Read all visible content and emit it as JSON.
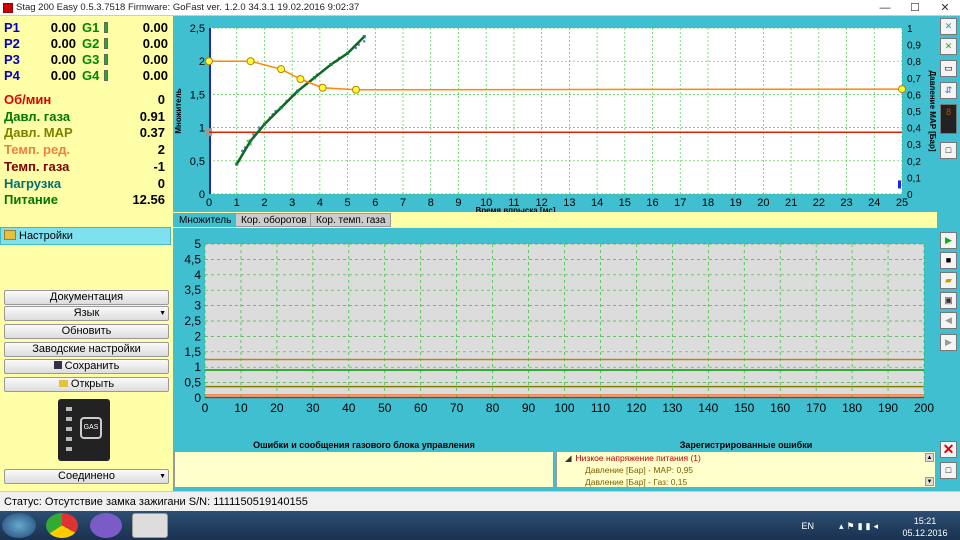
{
  "window": {
    "title": "Stag 200 Easy 0.5.3.7518 Firmware: GoFast  ver. 1.2.0  34.3.1  19.02.2016 9:02:37",
    "minimize": "—",
    "maximize": "☐",
    "close": "✕"
  },
  "injectors": [
    {
      "p_label": "P1",
      "p_value": "0.00",
      "g_label": "G1",
      "g_value": "0.00"
    },
    {
      "p_label": "P2",
      "p_value": "0.00",
      "g_label": "G2",
      "g_value": "0.00"
    },
    {
      "p_label": "P3",
      "p_value": "0.00",
      "g_label": "G3",
      "g_value": "0.00"
    },
    {
      "p_label": "P4",
      "p_value": "0.00",
      "g_label": "G4",
      "g_value": "0.00"
    }
  ],
  "sensors": [
    {
      "label": "Об/мин",
      "value": "0",
      "color": "#e00000"
    },
    {
      "label": "Давл. газа",
      "value": "0.91",
      "color": "#007700"
    },
    {
      "label": "Давл. MAP",
      "value": "0.37",
      "color": "#808000"
    },
    {
      "label": "Темп. ред.",
      "value": "2",
      "color": "#f08040"
    },
    {
      "label": "Темп. газа",
      "value": "-1",
      "color": "#800000"
    },
    {
      "label": "Нагрузка",
      "value": "0",
      "color": "#007070"
    },
    {
      "label": "Питание",
      "value": "12.56",
      "color": "#007700"
    }
  ],
  "settings_label": "Настройки",
  "buttons": {
    "docs": "Документация",
    "language": "Язык",
    "update": "Обновить",
    "factory": "Заводские настройки",
    "save": "Сохранить",
    "open": "Открыть",
    "connected": "Соединено"
  },
  "gas_label": "GAS",
  "tabs": [
    "Множитель",
    "Кор. оборотов",
    "Кор. темп. газа"
  ],
  "errors": {
    "header_left": "Ошибки и сообщения газового блока управления",
    "header_right": "Зарегистрированные ошибки",
    "items": [
      {
        "text": "Низкое напряжение питания (1)",
        "color": "#c00000"
      },
      {
        "text": "Давление [Бар] - MAP: 0,95",
        "color": "#806000"
      },
      {
        "text": "Давление [Бар] - Газ: 0,15",
        "color": "#806000"
      }
    ]
  },
  "status": "Статус: Отсутствие замка зажигани S/N: 1111150519140155",
  "tray": {
    "lang": "EN",
    "time": "15:21",
    "date": "05.12.2016"
  },
  "chart_data": [
    {
      "type": "scatter",
      "title": "",
      "xlabel": "Время впрыска [мс]",
      "ylabel": "Множитель",
      "y2label": "Давление MAP [Бар]",
      "xlim": [
        0,
        25
      ],
      "ylim": [
        0,
        2.5
      ],
      "y2lim": [
        0,
        1
      ],
      "x_ticks": [
        0,
        1,
        2,
        3,
        4,
        5,
        6,
        7,
        8,
        9,
        10,
        11,
        12,
        13,
        14,
        15,
        16,
        17,
        18,
        19,
        20,
        21,
        22,
        23,
        24,
        25
      ],
      "y_ticks": [
        "0",
        "0,5",
        "1",
        "1,5",
        "2",
        "2,5"
      ],
      "y2_ticks": [
        "0",
        "0,1",
        "0,2",
        "0,3",
        "0,4",
        "0,5",
        "0,6",
        "0,7",
        "0,8",
        "0,9",
        "1"
      ],
      "grid": true,
      "multiplier_curve": {
        "x": [
          0,
          1.5,
          2.6,
          3.3,
          4.1,
          5.3,
          25
        ],
        "y": [
          2.0,
          2.0,
          1.88,
          1.73,
          1.6,
          1.57,
          1.58
        ]
      },
      "reference_line_y": 0.93,
      "fit_line": {
        "x": [
          1.0,
          1.5,
          2.0,
          2.6,
          3.2,
          3.8,
          4.4,
          5.0,
          5.6
        ],
        "y": [
          0.45,
          0.8,
          1.05,
          1.3,
          1.55,
          1.75,
          1.95,
          2.12,
          2.37
        ]
      },
      "scatter_points": {
        "x": [
          1.1,
          1.2,
          1.3,
          1.4,
          1.6,
          1.8,
          2.0,
          2.2,
          2.4,
          2.6,
          2.8,
          3.0,
          3.2,
          3.5,
          3.8,
          4.1,
          4.4,
          4.7,
          5.0,
          5.3,
          5.6,
          1.5,
          2.3,
          3.1,
          3.9,
          4.6,
          5.4
        ],
        "y": [
          0.5,
          0.65,
          0.7,
          0.8,
          0.9,
          1.0,
          1.05,
          1.15,
          1.25,
          1.3,
          1.4,
          1.48,
          1.55,
          1.65,
          1.75,
          1.85,
          1.95,
          2.05,
          2.12,
          2.2,
          2.3,
          0.75,
          1.2,
          1.5,
          1.8,
          2.0,
          2.25
        ]
      }
    },
    {
      "type": "line",
      "title": "",
      "xlim": [
        0,
        200
      ],
      "ylim": [
        0,
        5
      ],
      "x_ticks": [
        0,
        10,
        20,
        30,
        40,
        50,
        60,
        70,
        80,
        90,
        100,
        110,
        120,
        130,
        140,
        150,
        160,
        170,
        180,
        190,
        200
      ],
      "y_ticks": [
        "0",
        "0,5",
        "1",
        "1,5",
        "2",
        "2,5",
        "3",
        "3,5",
        "4",
        "4,5",
        "5"
      ],
      "grid": true,
      "series": [
        {
          "color": "#c08020",
          "values": [
            1.25
          ]
        },
        {
          "color": "#009900",
          "values": [
            0.91
          ]
        },
        {
          "color": "#808000",
          "values": [
            0.37
          ]
        },
        {
          "color": "#f08040",
          "values": [
            0.1
          ]
        },
        {
          "color": "#cc2200",
          "values": [
            0.02
          ]
        }
      ]
    }
  ]
}
